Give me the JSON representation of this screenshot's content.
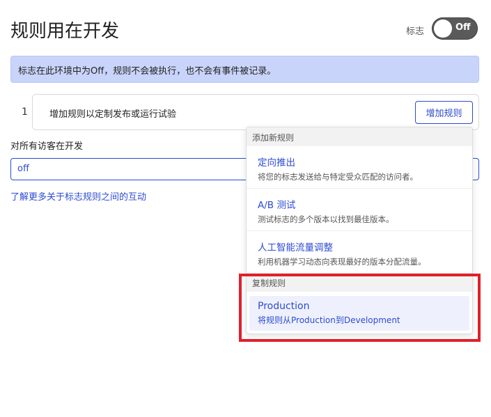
{
  "header": {
    "title": "规则用在开发",
    "flag_label": "标志",
    "toggle_text": "Off"
  },
  "banner": {
    "text": "标志在此环境中为Off，规则不会被执行，也不会有事件被记录。"
  },
  "rule": {
    "number": "1",
    "text": "增加规则以定制发布或运行试验",
    "add_button": "增加规则"
  },
  "default_rule": {
    "label": "对所有访客在开发",
    "value": "off"
  },
  "learn_link": "了解更多关于标志规则之间的互动",
  "dropdown": {
    "add_header": "添加新规则",
    "items": [
      {
        "title": "定向推出",
        "desc": "将您的标志发送给与特定受众匹配的访问者。"
      },
      {
        "title": "A/B 测试",
        "desc": "测试标志的多个版本以找到最佳版本。"
      },
      {
        "title": "人工智能流量调整",
        "desc": "利用机器学习动态向表现最好的版本分配流量。"
      }
    ],
    "copy_header": "复制规则",
    "copy_item": {
      "title": "Production",
      "desc": "将规则从Production到Development"
    }
  },
  "colors": {
    "accent": "#2c4bd1",
    "banner_bg": "#c9d4fb",
    "highlight": "#e0202a",
    "toggle_bg": "#5a5a5a"
  }
}
